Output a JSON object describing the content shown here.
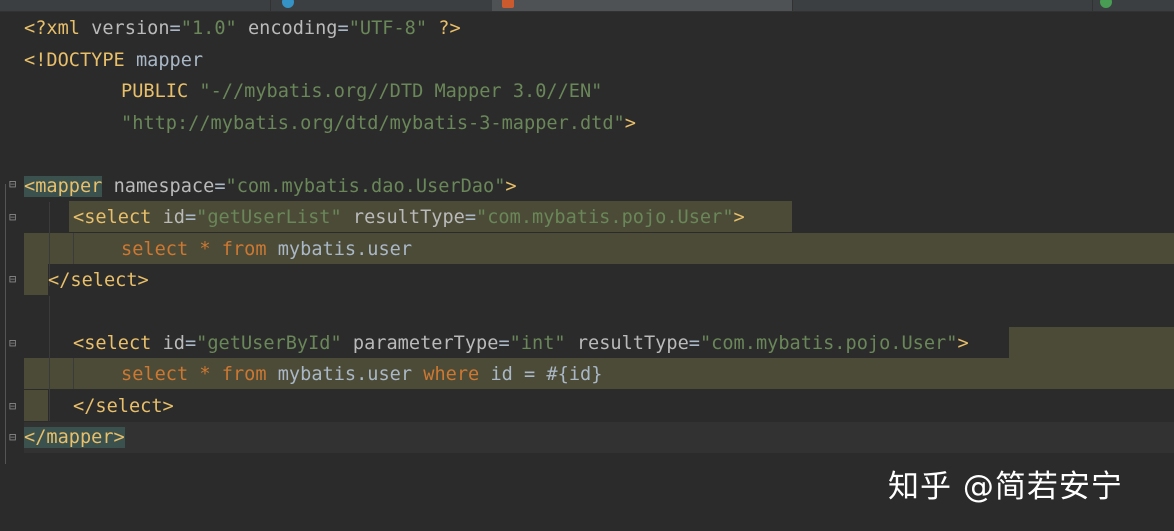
{
  "editor": {
    "lines": {
      "l1": {
        "pi_open": "<?xml ",
        "a1": "version",
        "eq": "=",
        "v1": "\"1.0\"",
        "sp": " ",
        "a2": "encoding",
        "v2": "\"UTF-8\"",
        "pi_close": " ?>"
      },
      "l2": {
        "doctype": "<!DOCTYPE ",
        "name": "mapper"
      },
      "l3": {
        "kw": "PUBLIC ",
        "s": "\"-//mybatis.org//DTD Mapper 3.0//EN\""
      },
      "l4": {
        "s": "\"http://mybatis.org/dtd/mybatis-3-mapper.dtd\"",
        "close": ">"
      },
      "l6": {
        "open": "<mapper",
        "attr": " namespace",
        "eq": "=",
        "val": "\"com.mybatis.dao.UserDao\"",
        "close": ">"
      },
      "l7": {
        "open": "<select",
        "a1": " id",
        "eq": "=",
        "v1": "\"getUserList\"",
        "a2": " resultType",
        "v2": "\"com.mybatis.pojo.User\"",
        "close": ">"
      },
      "l8": {
        "k1": "select",
        "star": " * ",
        "k2": "from",
        "rest": " mybatis.user"
      },
      "l9": {
        "tag": "</select>"
      },
      "l11": {
        "open": "<select",
        "a1": " id",
        "eq": "=",
        "v1": "\"getUserById\"",
        "a2": " parameterType",
        "v2": "\"int\"",
        "a3": " resultType",
        "v3": "\"com.mybatis.pojo.User\"",
        "close": ">"
      },
      "l12": {
        "k1": "select",
        "star": " * ",
        "k2": "from",
        "mid": " mybatis.user ",
        "k3": "where",
        "rest": " id = #{id}"
      },
      "l13": {
        "tag": "</select>"
      },
      "l14": {
        "tag": "</mapper>"
      }
    }
  },
  "watermark": "知乎 @简若安宁",
  "colors": {
    "background": "#2b2b2b",
    "string": "#6a8759",
    "tag": "#e8bf6a",
    "keyword": "#cc7832",
    "highlight": "#4c4b37"
  }
}
